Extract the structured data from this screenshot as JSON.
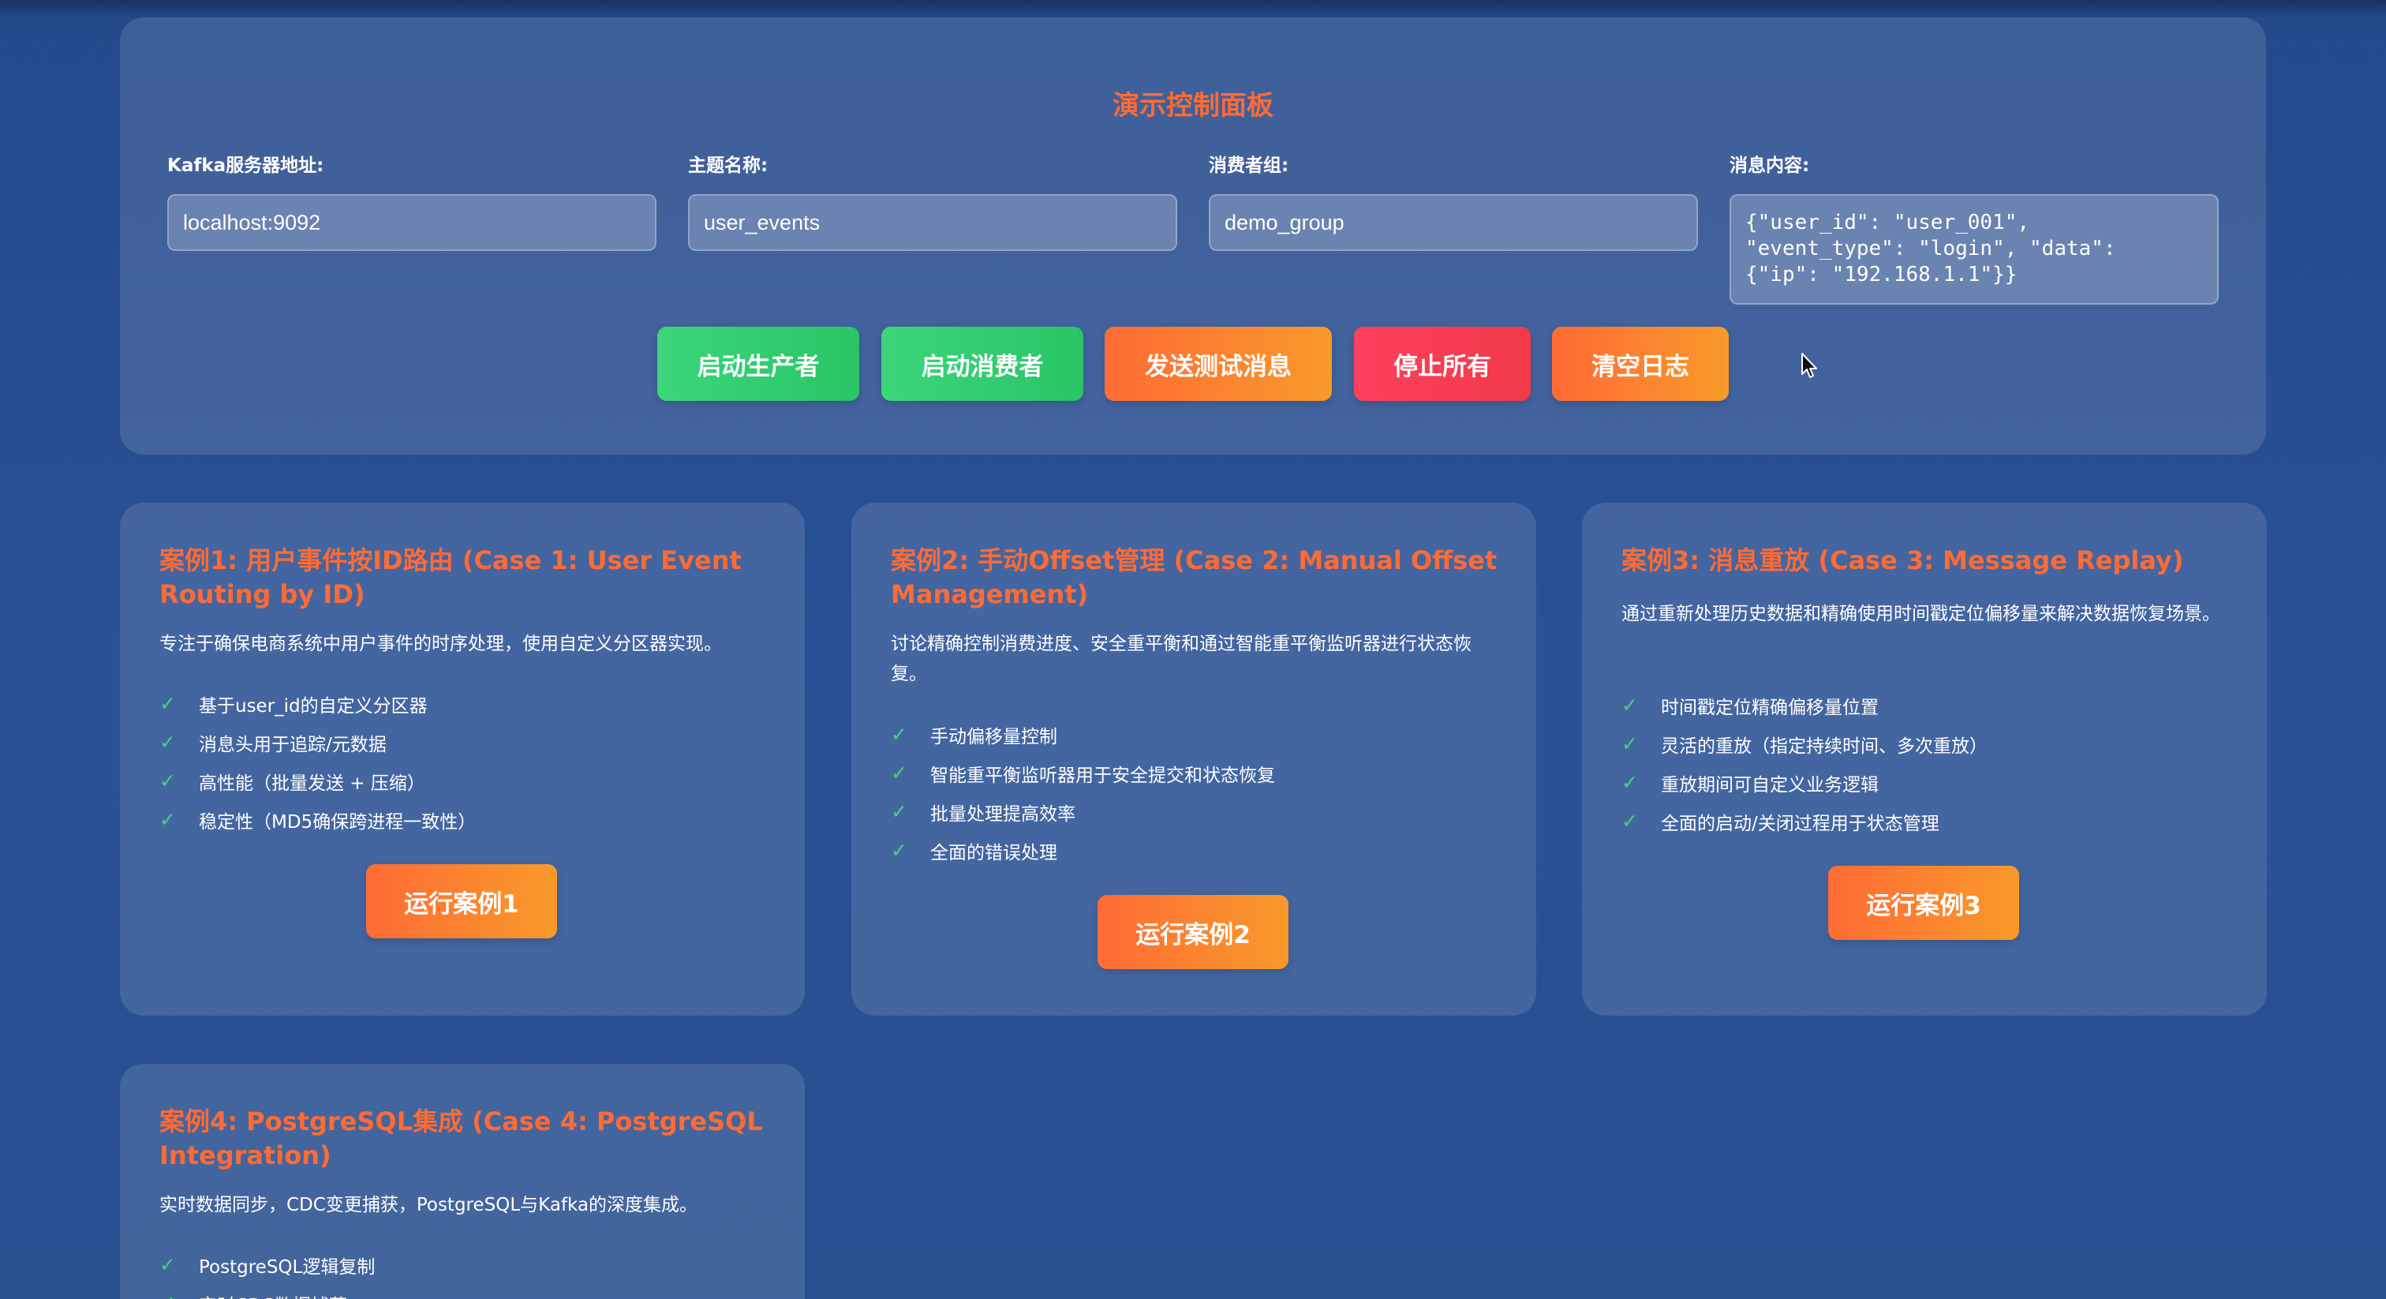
{
  "control_panel": {
    "title": "演示控制面板",
    "fields": {
      "kafka_server": {
        "label": "Kafka服务器地址:",
        "value": "localhost:9092"
      },
      "topic": {
        "label": "主题名称:",
        "value": "user_events"
      },
      "consumer_group": {
        "label": "消费者组:",
        "value": "demo_group"
      },
      "message": {
        "label": "消息内容:",
        "value": "{\"user_id\": \"user_001\",\n\"event_type\": \"login\", \"data\":\n{\"ip\": \"192.168.1.1\"}}"
      }
    },
    "buttons": {
      "start_producer": "启动生产者",
      "start_consumer": "启动消费者",
      "send_test": "发送测试消息",
      "stop_all": "停止所有",
      "clear_log": "清空日志"
    },
    "colors": {
      "green": "#2ecc71",
      "orange": "#ff6b35",
      "red": "#ff3f5c"
    }
  },
  "cases": [
    {
      "title": "案例1: 用户事件按ID路由 (Case 1: User Event Routing by ID)",
      "description": "专注于确保电商系统中用户事件的时序处理，使用自定义分区器实现。",
      "features": [
        "基于user_id的自定义分区器",
        "消息头用于追踪/元数据",
        "高性能（批量发送 + 压缩）",
        "稳定性（MD5确保跨进程一致性）"
      ],
      "button": "运行案例1"
    },
    {
      "title": "案例2: 手动Offset管理 (Case 2: Manual Offset Management)",
      "description": "讨论精确控制消费进度、安全重平衡和通过智能重平衡监听器进行状态恢复。",
      "features": [
        "手动偏移量控制",
        "智能重平衡监听器用于安全提交和状态恢复",
        "批量处理提高效率",
        "全面的错误处理"
      ],
      "button": "运行案例2"
    },
    {
      "title": "案例3: 消息重放 (Case 3: Message Replay)",
      "description": "通过重新处理历史数据和精确使用时间戳定位偏移量来解决数据恢复场景。",
      "features": [
        "时间戳定位精确偏移量位置",
        "灵活的重放（指定持续时间、多次重放）",
        "重放期间可自定义业务逻辑",
        "全面的启动/关闭过程用于状态管理"
      ],
      "button": "运行案例3"
    },
    {
      "title": "案例4: PostgreSQL集成 (Case 4: PostgreSQL Integration)",
      "description": "实时数据同步，CDC变更捕获，PostgreSQL与Kafka的深度集成。",
      "features": [
        "PostgreSQL逻辑复制",
        "实时CDC数据捕获"
      ]
    }
  ]
}
